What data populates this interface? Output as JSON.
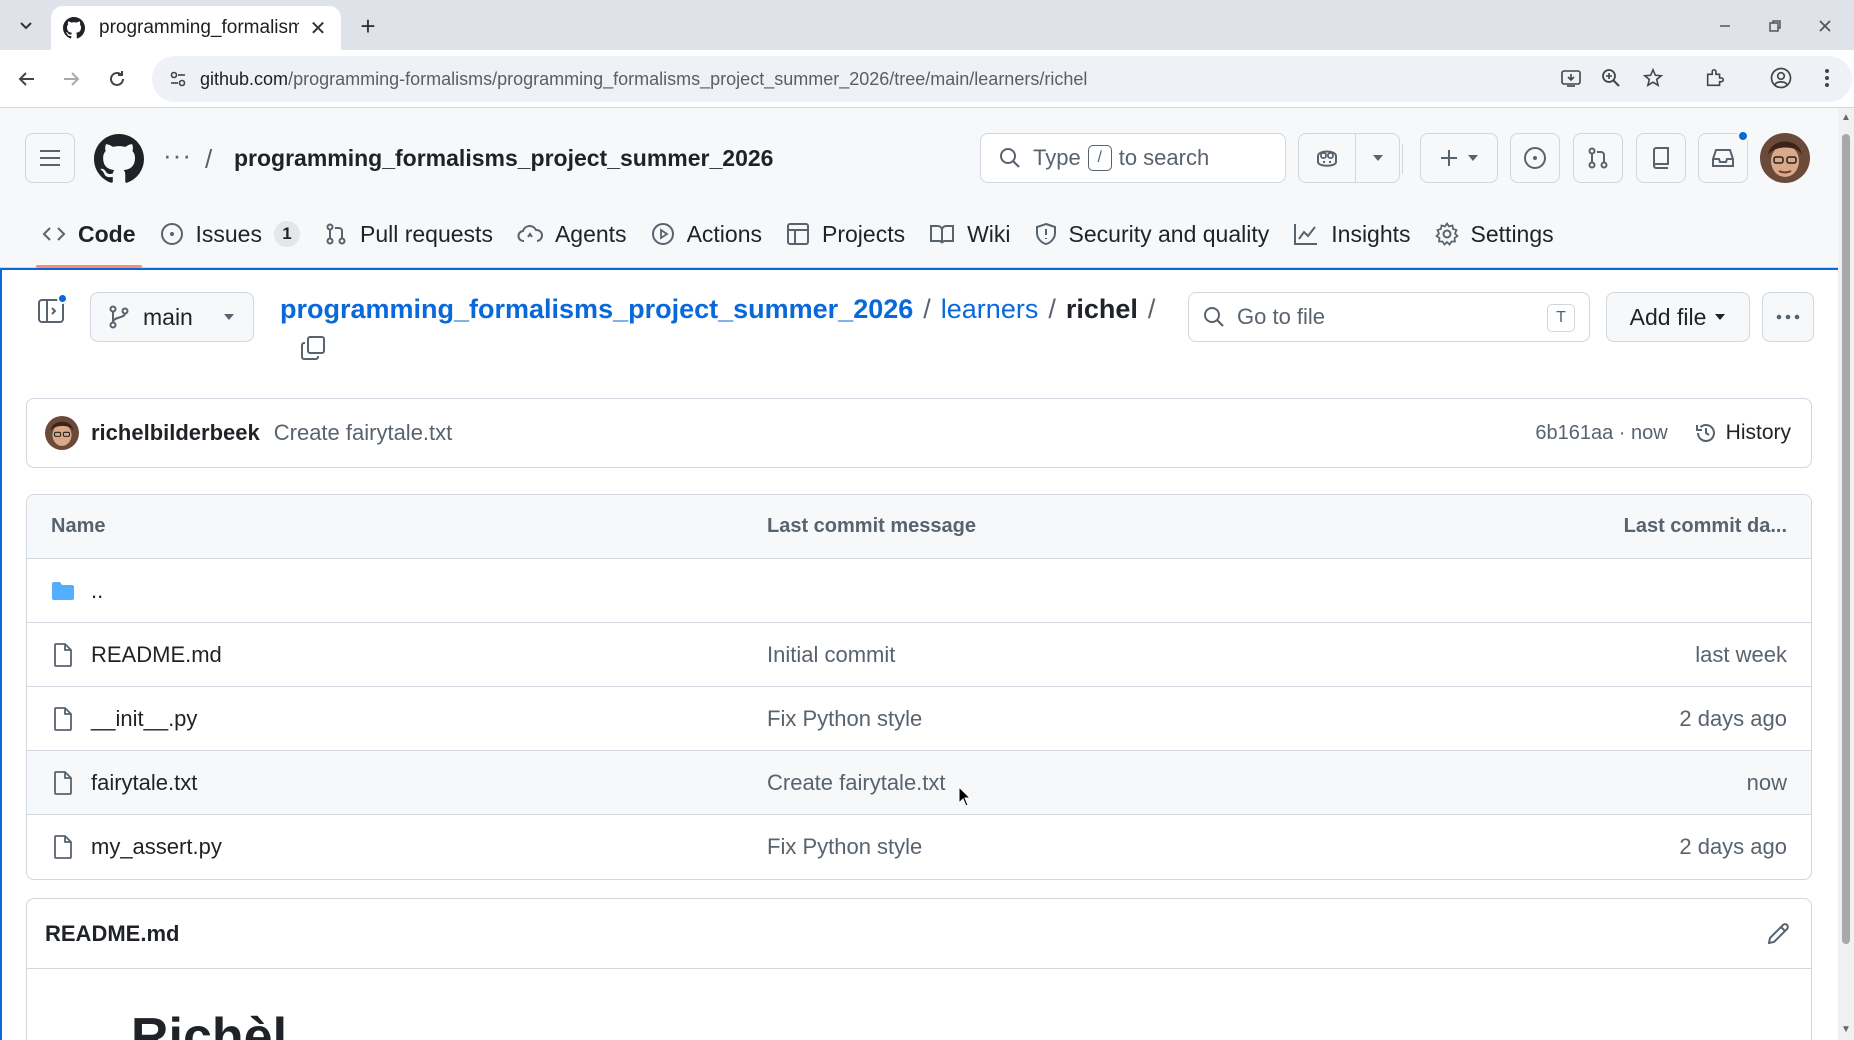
{
  "browser": {
    "tab_title": "programming_formalism",
    "url_host": "github.com",
    "url_path": "/programming-formalisms/programming_formalisms_project_summer_2026/tree/main/learners/richel"
  },
  "header": {
    "repo_name": "programming_formalisms_project_summer_2026",
    "search_type": "Type",
    "search_key": "/",
    "search_suffix": "to search"
  },
  "repo_nav": {
    "code": "Code",
    "issues": "Issues",
    "issues_count": "1",
    "pull_requests": "Pull requests",
    "agents": "Agents",
    "actions": "Actions",
    "projects": "Projects",
    "wiki": "Wiki",
    "security": "Security and quality",
    "insights": "Insights",
    "settings": "Settings"
  },
  "toolbar": {
    "branch": "main",
    "path_repo": "programming_formalisms_project_summer_2026",
    "path_dir": "learners",
    "path_current": "richel",
    "sep": "/",
    "goto_placeholder": "Go to file",
    "goto_key": "T",
    "add_file": "Add file"
  },
  "commit": {
    "author": "richelbilderbeek",
    "message": "Create fairytale.txt",
    "sha_time": "6b161aa · now",
    "history": "History"
  },
  "table": {
    "headers": {
      "name": "Name",
      "message": "Last commit message",
      "date": "Last commit da..."
    },
    "parent": "..",
    "rows": [
      {
        "name": "README.md",
        "message": "Initial commit",
        "date": "last week"
      },
      {
        "name": "__init__.py",
        "message": "Fix Python style",
        "date": "2 days ago"
      },
      {
        "name": "fairytale.txt",
        "message": "Create fairytale.txt",
        "date": "now"
      },
      {
        "name": "my_assert.py",
        "message": "Fix Python style",
        "date": "2 days ago"
      }
    ]
  },
  "readme": {
    "title": "README.md",
    "heading": "Richèl"
  },
  "colors": {
    "link": "#0969da",
    "active_underline": "#fd8c73",
    "border": "#d0d7de"
  }
}
